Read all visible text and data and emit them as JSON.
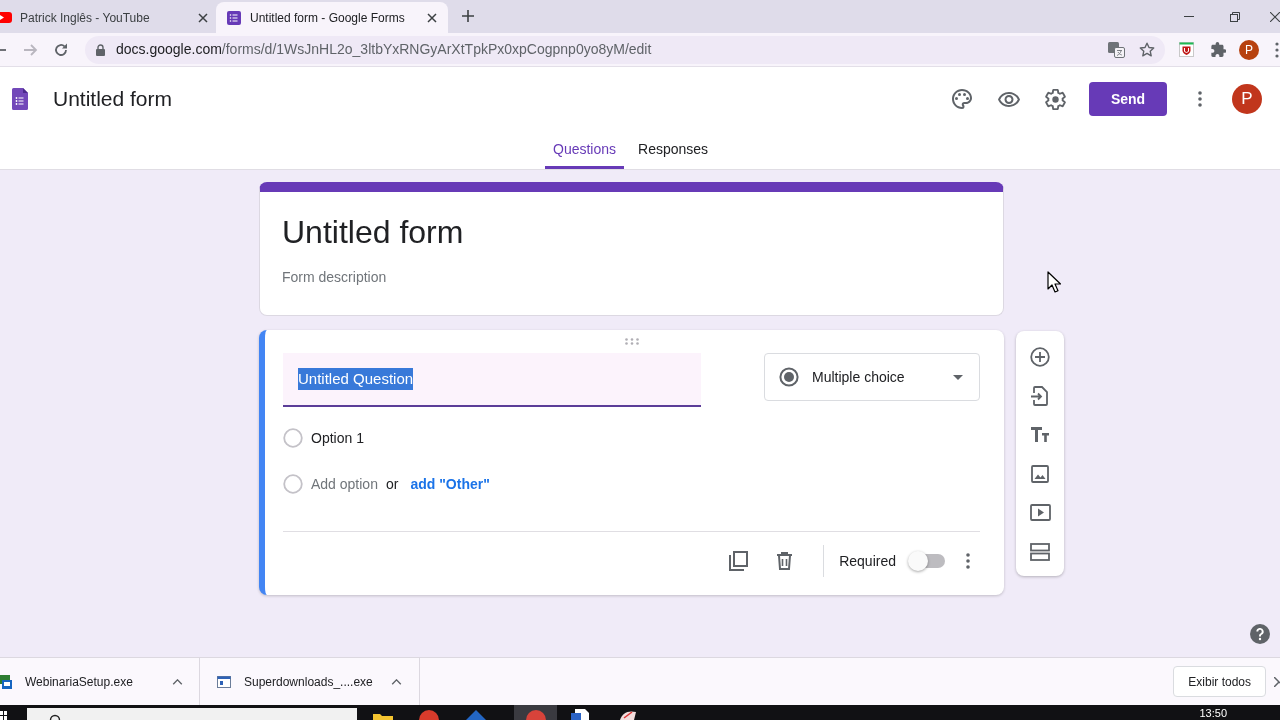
{
  "browser": {
    "tabs": [
      {
        "title": "Patrick Inglês - YouTube",
        "selected": false
      },
      {
        "title": "Untitled form - Google Forms",
        "selected": true
      }
    ],
    "address": {
      "host": "docs.google.com",
      "path": "/forms/d/1WsJnHL2o_3ltbYxRNGyArXtTpkPx0xpCogpnp0yo8yM/edit"
    },
    "profile_initial": "P"
  },
  "app": {
    "title": "Untitled form",
    "send_label": "Send",
    "avatar_initial": "P",
    "tabs": [
      {
        "label": "Questions",
        "selected": true
      },
      {
        "label": "Responses",
        "selected": false
      }
    ]
  },
  "form": {
    "title": "Untitled form",
    "description_placeholder": "Form description"
  },
  "question": {
    "title": "Untitled Question",
    "title_selected": true,
    "type": "Multiple choice",
    "options": [
      {
        "label": "Option 1"
      }
    ],
    "add_option": "Add option",
    "or": "or",
    "add_other": "add \"Other\"",
    "required_label": "Required",
    "required": false
  },
  "downloads": {
    "items": [
      {
        "name": "WebinariaSetup.exe"
      },
      {
        "name": "Superdownloads_....exe"
      }
    ],
    "show_all": "Exibir todos"
  },
  "taskbar": {
    "time": "13:50"
  }
}
